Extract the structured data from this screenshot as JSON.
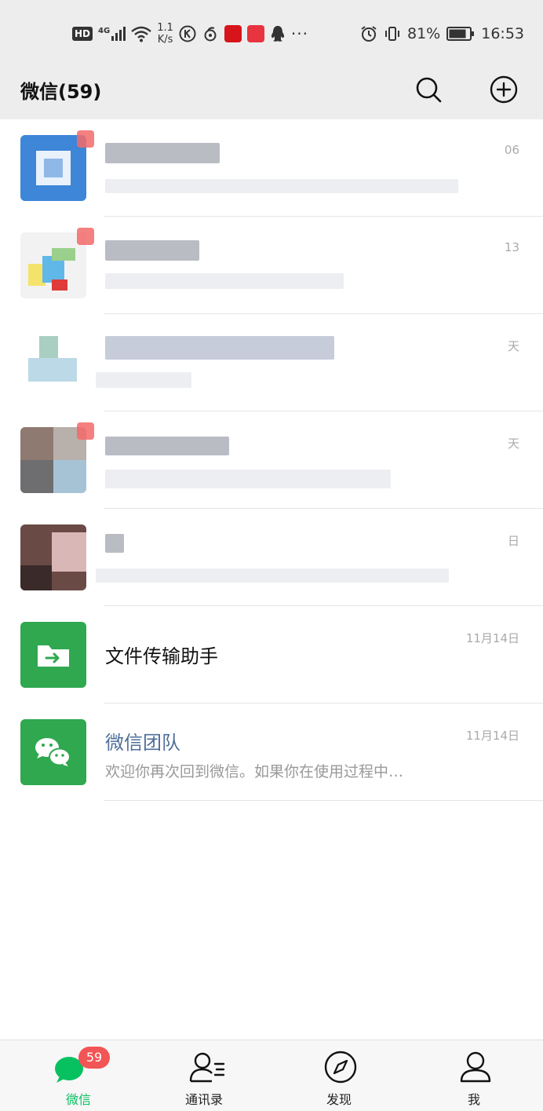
{
  "status_bar": {
    "hd": "HD",
    "network": "4G",
    "net_speed_value": "1.1",
    "net_speed_unit": "K/s",
    "app_icons": [
      "kugou-icon",
      "weibo-icon",
      "netease-news-icon",
      "book-icon",
      "qq-icon"
    ],
    "more": "···",
    "battery_percent": "81%",
    "time": "16:53"
  },
  "header": {
    "title": "微信(59)",
    "search_icon": "search-icon",
    "add_icon": "plus-circle-icon"
  },
  "chats": [
    {
      "name": "",
      "preview": "",
      "time": "06",
      "avatar": "blurred-blue"
    },
    {
      "name": "",
      "preview": "",
      "time": "13",
      "avatar": "blurred-colorful"
    },
    {
      "name": "",
      "preview": "",
      "time": "天",
      "avatar": "blurred-light"
    },
    {
      "name": "",
      "preview": "",
      "time": "天",
      "avatar": "blurred-mixed"
    },
    {
      "name": "",
      "preview": "",
      "time": "日",
      "avatar": "blurred-photo"
    },
    {
      "name": "文件传输助手",
      "preview": "",
      "time": "11月14日",
      "avatar": "file-transfer-icon"
    },
    {
      "name": "微信团队",
      "preview": "欢迎你再次回到微信。如果你在使用过程中…",
      "time": "11月14日",
      "avatar": "wechat-logo-icon"
    }
  ],
  "tabs": [
    {
      "label": "微信",
      "icon": "chat-bubble-icon",
      "badge": "59",
      "active": true
    },
    {
      "label": "通讯录",
      "icon": "contacts-icon",
      "active": false
    },
    {
      "label": "发现",
      "icon": "compass-icon",
      "active": false
    },
    {
      "label": "我",
      "icon": "person-icon",
      "active": false
    }
  ],
  "colors": {
    "accent_green": "#07c160",
    "header_bg": "#ededed",
    "badge_red": "#f25555",
    "team_name": "#4f6f99"
  }
}
